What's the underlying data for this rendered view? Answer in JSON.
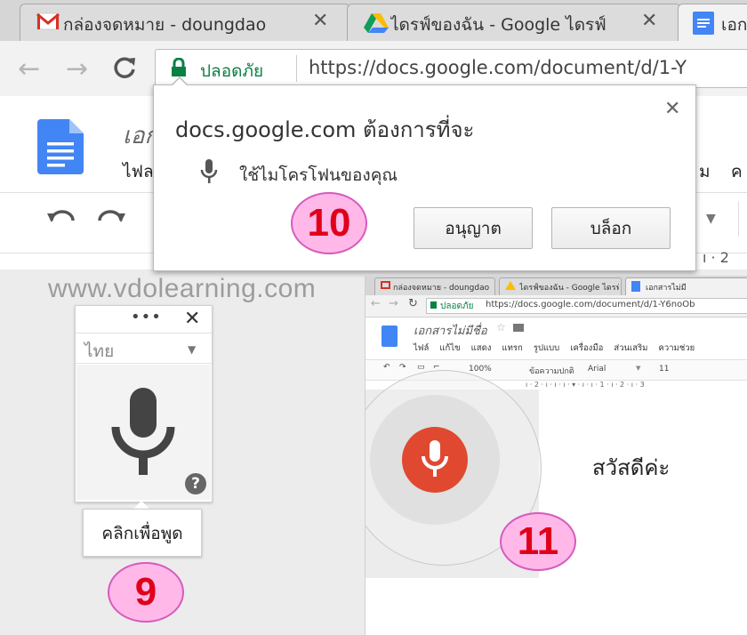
{
  "browser": {
    "tabs": [
      {
        "title": "กล่องจดหมาย - doungdao",
        "icon": "gmail-icon"
      },
      {
        "title": "ไดรฟ์ของฉัน - Google ไดรฟ์",
        "icon": "drive-icon"
      },
      {
        "title": "เอก",
        "icon": "docs-icon"
      }
    ],
    "secure_label": "ปลอดภัย",
    "url": "https://docs.google.com/document/d/1-Y"
  },
  "docs": {
    "title_partial": "เอก",
    "menu_partial_left": "ไฟล",
    "menu_partial_right": "ม",
    "menu_partial_far": "ค",
    "ruler_partial": "ı · 2"
  },
  "permission_popup": {
    "heading": "docs.google.com ต้องการที่จะ",
    "request": "ใช้ไมโครโฟนของคุณ",
    "allow_label": "อนุญาต",
    "block_label": "บล็อก"
  },
  "watermark": "www.vdolearning.com",
  "voice_widget": {
    "menu": "•••",
    "close": "✕",
    "language": "ไทย",
    "help": "?",
    "tooltip": "คลิกเพื่อพูด"
  },
  "steps": {
    "nine": "9",
    "ten": "10",
    "eleven": "11"
  },
  "inset": {
    "tabs": [
      "กล่องจดหมาย - doungdao",
      "ไดรฟ์ของฉัน - Google ไดรฟ์",
      "เอกสารไม่มี"
    ],
    "secure_label": "ปลอดภัย",
    "url": "https://docs.google.com/document/d/1-Y6noOb",
    "doc_title": "เอกสารไม่มีชื่อ",
    "menu": [
      "ไฟล์",
      "แก้ไข",
      "แสดง",
      "แทรก",
      "รูปแบบ",
      "เครื่องมือ",
      "ส่วนเสริม",
      "ความช่วย"
    ],
    "zoom": "100%",
    "style": "ข้อความปกติ",
    "font": "Arial",
    "size": "11",
    "ruler": "ı · 2 · ı · ı · ı · ▾ · ı · ı · 1 · ı · 2 · ı · 3",
    "document_text": "สวัสดีค่ะ"
  },
  "colors": {
    "badge_fill": "#ffb8e8",
    "badge_text": "#e0001a",
    "mic_red": "#e0492f",
    "secure_green": "#0b8043",
    "docs_blue": "#4285f4"
  }
}
